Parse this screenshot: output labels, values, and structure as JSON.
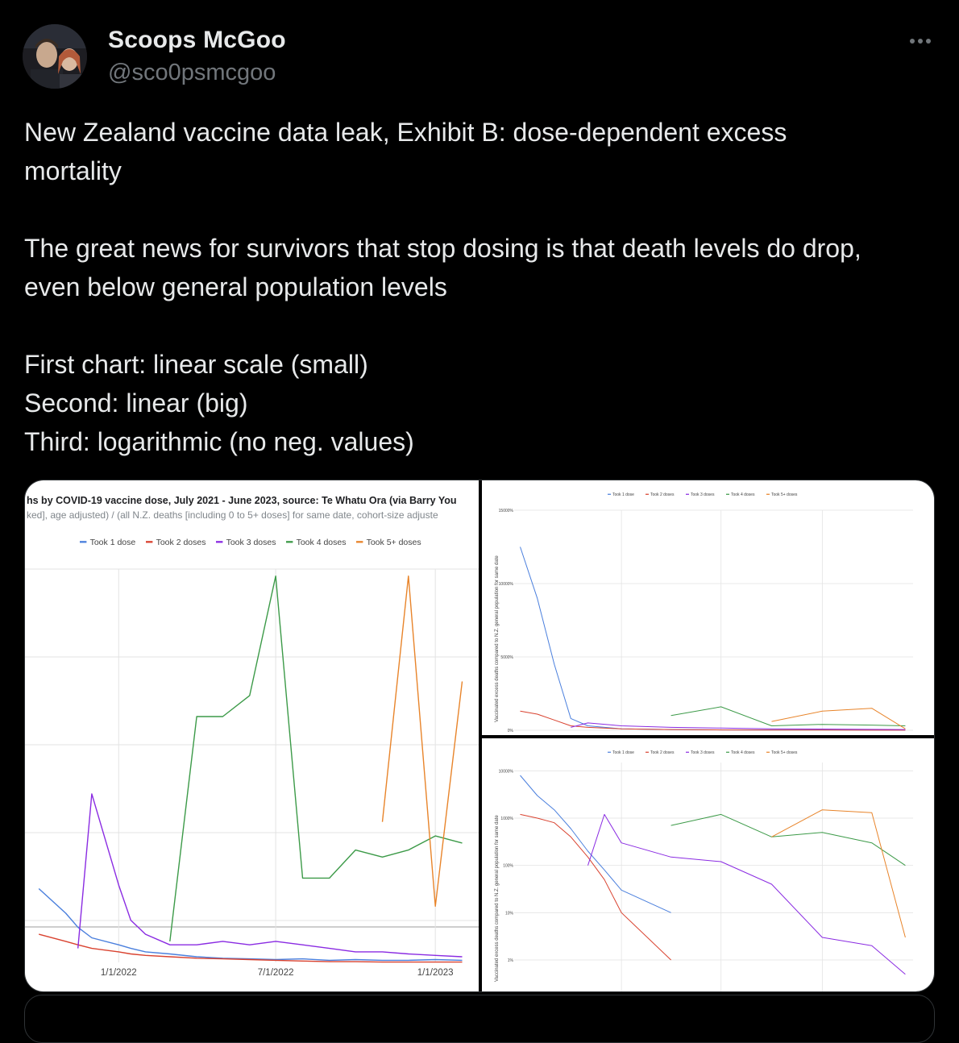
{
  "header": {
    "display_name": "Scoops McGoo",
    "handle": "@sco0psmcgoo",
    "more_icon": "ellipsis-icon"
  },
  "tweet": {
    "line1": "New Zealand vaccine data leak, Exhibit B: dose-dependent excess",
    "line2": "mortality",
    "line3": "The great news for survivors that stop dosing is that death levels do drop,",
    "line4": "even below general population levels",
    "line5": "First chart: linear scale (small)",
    "line6": "Second: linear (big)",
    "line7": "Third: logarithmic (no neg. values)"
  },
  "colors": {
    "dose1": "#4a7fdd",
    "dose2": "#d9422f",
    "dose3": "#8a2be2",
    "dose4": "#3c9a48",
    "dose5": "#e8842a"
  },
  "legend": [
    "Took 1 dose",
    "Took 2 doses",
    "Took 3 doses",
    "Took 4 doses",
    "Took 5+ doses"
  ],
  "chart_data": [
    {
      "type": "line",
      "title": "hs by COVID-19 vaccine dose, July 2021 - June 2023, source: Te Whatu Ora (via Barry You",
      "subtitle": "ked], age adjusted) / (all N.Z. deaths [including 0 to 5+ doses] for same date, cohort-size adjuste",
      "xlabel": "",
      "ylabel": "",
      "x_ticks": [
        "1/1/2022",
        "7/1/2022",
        "1/1/2023"
      ],
      "x": [
        "2021-10-01",
        "2021-11-01",
        "2021-11-15",
        "2021-12-01",
        "2022-01-01",
        "2022-01-15",
        "2022-02-01",
        "2022-03-01",
        "2022-04-01",
        "2022-05-01",
        "2022-06-01",
        "2022-07-01",
        "2022-08-01",
        "2022-09-01",
        "2022-10-01",
        "2022-11-01",
        "2022-12-01",
        "2023-01-01",
        "2023-02-01"
      ],
      "series": [
        {
          "name": "Took 1 dose",
          "values": [
            1050,
            700,
            500,
            350,
            250,
            200,
            150,
            120,
            80,
            60,
            50,
            40,
            50,
            30,
            40,
            30,
            30,
            40,
            30
          ]
        },
        {
          "name": "Took 2 doses",
          "values": [
            400,
            300,
            250,
            200,
            150,
            120,
            100,
            80,
            60,
            50,
            40,
            30,
            20,
            10,
            10,
            5,
            5,
            5,
            5
          ]
        },
        {
          "name": "Took 3 doses",
          "values": [
            null,
            null,
            200,
            2400,
            1100,
            600,
            400,
            250,
            250,
            300,
            250,
            300,
            250,
            200,
            150,
            150,
            120,
            100,
            80
          ]
        },
        {
          "name": "Took 4 doses",
          "values": [
            null,
            null,
            null,
            null,
            null,
            null,
            null,
            300,
            3500,
            3500,
            3800,
            5500,
            1200,
            1200,
            1600,
            1500,
            1600,
            1800,
            1700
          ]
        },
        {
          "name": "Took 5+ doses",
          "values": [
            null,
            null,
            null,
            null,
            null,
            null,
            null,
            null,
            null,
            null,
            null,
            null,
            null,
            null,
            null,
            2000,
            5500,
            800,
            4000
          ]
        }
      ]
    },
    {
      "type": "line",
      "ylabel": "Vaccinated excess deaths compared to N.Z. general population for same date",
      "y_ticks": [
        "0%",
        "5000%",
        "10000%",
        "15000%"
      ],
      "ylim": [
        0,
        15000
      ],
      "x": [
        "2021-07-01",
        "2021-08-01",
        "2021-09-01",
        "2021-10-01",
        "2021-11-01",
        "2022-01-01",
        "2022-04-01",
        "2022-07-01",
        "2022-10-01",
        "2023-01-01",
        "2023-04-01",
        "2023-06-01"
      ],
      "series": [
        {
          "name": "Took 1 dose",
          "values": [
            12500,
            9000,
            4500,
            800,
            300,
            100,
            50,
            30,
            20,
            20,
            10,
            10
          ]
        },
        {
          "name": "Took 2 doses",
          "values": [
            1300,
            1100,
            700,
            300,
            200,
            100,
            50,
            20,
            10,
            10,
            5,
            5
          ]
        },
        {
          "name": "Took 3 doses",
          "values": [
            null,
            null,
            null,
            200,
            500,
            300,
            200,
            150,
            100,
            80,
            60,
            50
          ]
        },
        {
          "name": "Took 4 doses",
          "values": [
            null,
            null,
            null,
            null,
            null,
            null,
            1000,
            1600,
            300,
            400,
            350,
            300
          ]
        },
        {
          "name": "Took 5+ doses",
          "values": [
            null,
            null,
            null,
            null,
            null,
            null,
            null,
            null,
            600,
            1300,
            1500,
            100
          ]
        }
      ]
    },
    {
      "type": "line",
      "ylabel": "Vaccinated excess deaths compared to N.Z. general population for same date",
      "y_ticks": [
        "1%",
        "10%",
        "100%",
        "1000%",
        "10000%"
      ],
      "ylim": [
        0.5,
        10000
      ],
      "x": [
        "2021-07-01",
        "2021-08-01",
        "2021-09-01",
        "2021-10-01",
        "2021-11-01",
        "2021-12-01",
        "2022-01-01",
        "2022-04-01",
        "2022-07-01",
        "2022-10-01",
        "2023-01-01",
        "2023-04-01",
        "2023-06-01"
      ],
      "series": [
        {
          "name": "Took 1 dose",
          "values": [
            8000,
            3000,
            1500,
            600,
            200,
            80,
            30,
            10,
            null,
            null,
            null,
            null,
            null
          ]
        },
        {
          "name": "Took 2 doses",
          "values": [
            1200,
            1000,
            800,
            400,
            150,
            50,
            10,
            1,
            null,
            null,
            null,
            null,
            null
          ]
        },
        {
          "name": "Took 3 doses",
          "values": [
            null,
            null,
            null,
            null,
            100,
            1200,
            300,
            150,
            120,
            40,
            3,
            2,
            0.5
          ]
        },
        {
          "name": "Took 4 doses",
          "values": [
            null,
            null,
            null,
            null,
            null,
            null,
            null,
            700,
            1200,
            400,
            500,
            300,
            100
          ]
        },
        {
          "name": "Took 5+ doses",
          "values": [
            null,
            null,
            null,
            null,
            null,
            null,
            null,
            null,
            null,
            400,
            1500,
            1300,
            3
          ]
        }
      ]
    }
  ]
}
